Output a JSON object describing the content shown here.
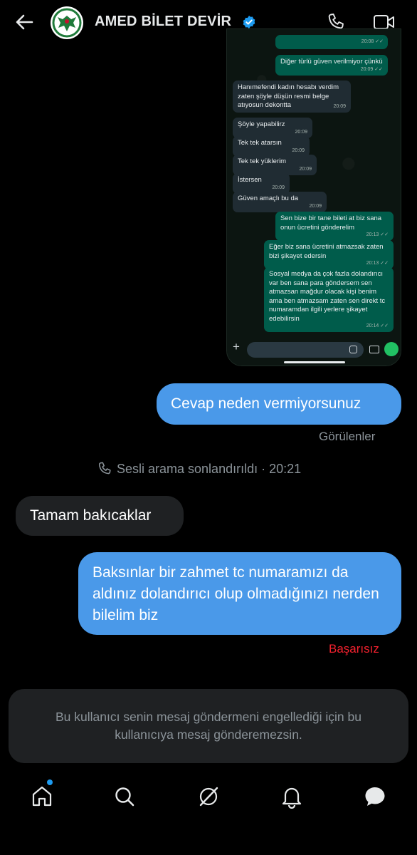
{
  "header": {
    "title": "AMED BİLET DEVİR",
    "verified": true,
    "avatar": "amed-logo",
    "icons": [
      "back-arrow-icon",
      "verified-badge-icon",
      "phone-icon",
      "video-icon"
    ]
  },
  "embedded_screenshot": {
    "messages": [
      {
        "dir": "out",
        "text": "Diğer türlü güven verilmiyor çünkü",
        "time": "20:09"
      },
      {
        "dir": "in",
        "text": "Hanımefendi kadın hesabı verdim zaten şöyle düşün resmi belge atıyosun dekontta",
        "time": "20:09"
      },
      {
        "dir": "in",
        "text": "Şöyle yapabilirz",
        "time": "20:09"
      },
      {
        "dir": "in",
        "text": "Tek tek atarsın",
        "time": "20:09"
      },
      {
        "dir": "in",
        "text": "Tek tek yüklerim",
        "time": "20:09"
      },
      {
        "dir": "in",
        "text": "İstersen",
        "time": "20:09"
      },
      {
        "dir": "in",
        "text": "Güven amaçlı bu da",
        "time": "20:09"
      },
      {
        "dir": "out",
        "text": "Sen bize bir tane bileti at biz sana onun ücretini gönderelim",
        "time": "20:13"
      },
      {
        "dir": "out",
        "text": "Eğer biz sana ücretini atmazsak zaten bizi şikayet edersin",
        "time": "20:13"
      },
      {
        "dir": "out",
        "text": "Sosyal medya da çok fazla dolandırıcı var ben sana para göndersem sen atmazsan mağdur olacak kişi benim ama ben atmazsam zaten sen direkt tc numaramdan ilgili yerlere şikayet edebilirsin",
        "time": "20:14"
      }
    ],
    "input_plus": "+"
  },
  "chat": {
    "msg1": "Cevap neden vermiyorsunuz",
    "msg1_status": "Görülenler",
    "call_event": "Sesli arama sonlandırıldı · 20:21",
    "msg2": "Tamam bakıcaklar",
    "msg3": "Baksınlar bir zahmet tc numaramızı da aldınız dolandırıcı olup olmadığınızı nerden bilelim biz",
    "msg3_status": "Başarısız"
  },
  "notice": "Bu kullanıcı senin mesaj göndermeni engellediği için bu kullanıcıya mesaj gönderemezsin.",
  "nav": {
    "items": [
      "home-icon",
      "search-icon",
      "grok-icon",
      "notifications-icon",
      "messages-icon"
    ],
    "accent": "#1d9bf0"
  },
  "colors": {
    "outgoing_bubble": "#4a99e9",
    "incoming_bubble": "#1f2123",
    "failed": "#f4212e",
    "whatsapp_out": "#005c4b"
  }
}
